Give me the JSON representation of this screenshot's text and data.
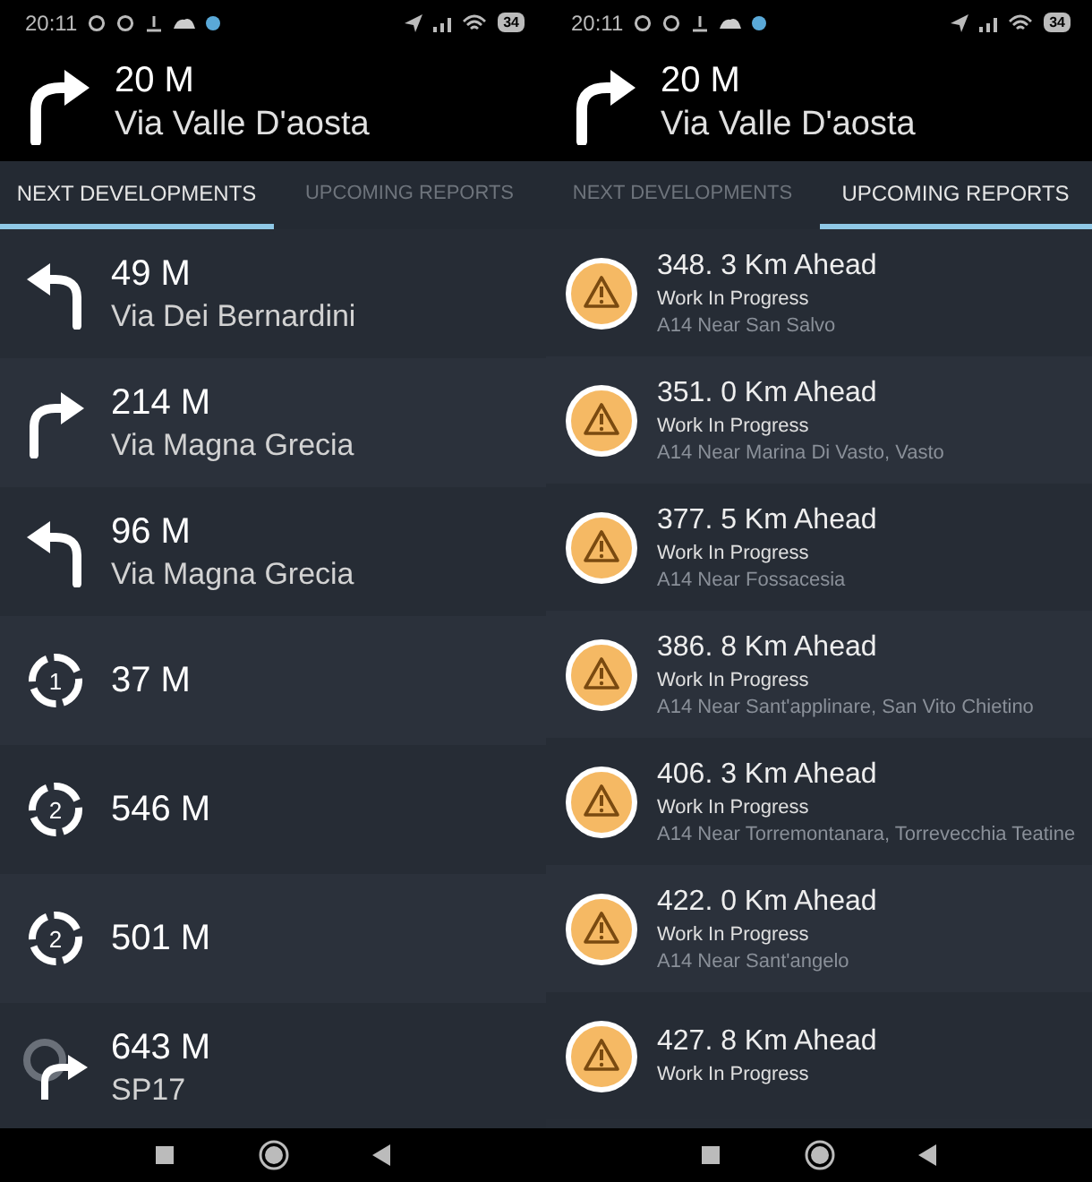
{
  "screens": [
    {
      "status_bar": {
        "time": "20:11",
        "battery": "34"
      },
      "current": {
        "kind": "right",
        "distance": "20 M",
        "street": "Via Valle D'aosta"
      },
      "tabs": [
        {
          "label": "NEXT DEVELOPMENTS",
          "selected": true
        },
        {
          "label": "UPCOMING REPORTS",
          "selected": false
        }
      ],
      "maneuvers": [
        {
          "kind": "left",
          "distance": "49 M",
          "street": "Via Dei Bernardini"
        },
        {
          "kind": "right",
          "distance": "214 M",
          "street": "Via Magna Grecia"
        },
        {
          "kind": "left",
          "distance": "96 M",
          "street": "Via Magna Grecia"
        },
        {
          "kind": "roundabout",
          "exit": "1",
          "distance": "37 M"
        },
        {
          "kind": "roundabout",
          "exit": "2",
          "distance": "546 M"
        },
        {
          "kind": "roundabout",
          "exit": "2",
          "distance": "501 M"
        },
        {
          "kind": "roundabout-right",
          "distance": "643 M",
          "street": "SP17"
        }
      ]
    },
    {
      "status_bar": {
        "time": "20:11",
        "battery": "34"
      },
      "current": {
        "kind": "right",
        "distance": "20 M",
        "street": "Via Valle D'aosta"
      },
      "tabs": [
        {
          "label": "NEXT DEVELOPMENTS",
          "selected": false
        },
        {
          "label": "UPCOMING REPORTS",
          "selected": true
        }
      ],
      "reports": [
        {
          "distance": "348. 3 Km Ahead",
          "type": "Work In Progress",
          "location": "A14 Near San Salvo"
        },
        {
          "distance": "351. 0 Km Ahead",
          "type": "Work In Progress",
          "location": "A14 Near Marina Di Vasto, Vasto"
        },
        {
          "distance": "377. 5 Km Ahead",
          "type": "Work In Progress",
          "location": "A14 Near Fossacesia"
        },
        {
          "distance": "386. 8 Km Ahead",
          "type": "Work In Progress",
          "location": "A14 Near Sant'applinare, San Vito Chietino"
        },
        {
          "distance": "406. 3 Km Ahead",
          "type": "Work In Progress",
          "location": "A14 Near Torremontanara, Torrevecchia Teatine"
        },
        {
          "distance": "422. 0 Km Ahead",
          "type": "Work In Progress",
          "location": "A14 Near Sant'angelo"
        },
        {
          "distance": "427. 8 Km Ahead",
          "type": "Work In Progress"
        }
      ]
    }
  ]
}
